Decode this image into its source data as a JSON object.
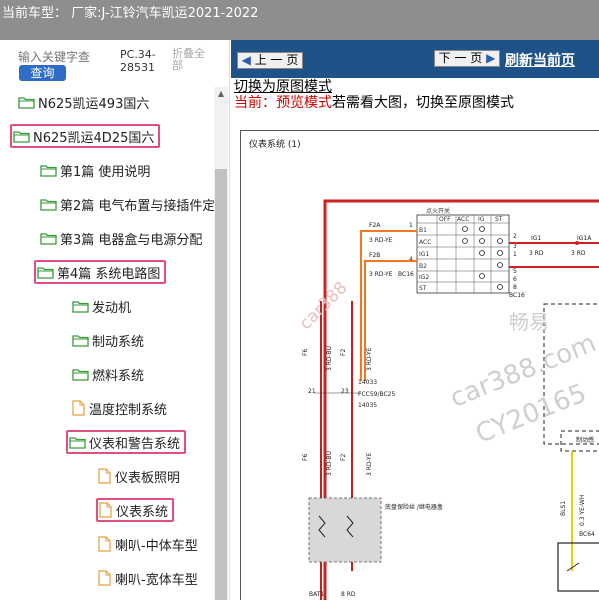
{
  "topbar": {
    "title": "当前车型： 厂家:J-江铃汽车凯运2021-2022"
  },
  "search": {
    "placeholder": "输入关键字查",
    "button_label": "查询",
    "pc_code": "PC.34-28531",
    "collapse_all": "折叠全部"
  },
  "tree": [
    {
      "label": "N625凯运493国六",
      "type": "folder",
      "highlighted": false
    },
    {
      "label": "N625凯运4D25国六",
      "type": "folder",
      "highlighted": true
    },
    {
      "label": "第1篇 使用说明",
      "type": "folder",
      "highlighted": false
    },
    {
      "label": "第2篇 电气布置与接插件定",
      "type": "folder",
      "highlighted": false
    },
    {
      "label": "第3篇 电器盒与电源分配",
      "type": "folder",
      "highlighted": false
    },
    {
      "label": "第4篇 系统电路图",
      "type": "folder",
      "highlighted": true
    },
    {
      "label": "发动机",
      "type": "folder",
      "highlighted": false
    },
    {
      "label": "制动系统",
      "type": "folder",
      "highlighted": false
    },
    {
      "label": "燃料系统",
      "type": "folder",
      "highlighted": false
    },
    {
      "label": "温度控制系统",
      "type": "doc",
      "highlighted": false
    },
    {
      "label": "仪表和警告系统",
      "type": "folder",
      "highlighted": true
    },
    {
      "label": "仪表板照明",
      "type": "doc",
      "highlighted": false
    },
    {
      "label": "仪表系统",
      "type": "doc",
      "highlighted": true
    },
    {
      "label": "喇叭-中体车型",
      "type": "doc",
      "highlighted": false
    },
    {
      "label": "喇叭-宽体车型",
      "type": "doc",
      "highlighted": false
    }
  ],
  "nav": {
    "prev_label": "上 一 页",
    "next_label": "下 一 页",
    "refresh_label": "刷新当前页"
  },
  "mode": {
    "switch_link": "切换为原图模式",
    "current_prefix": "当前：预览模式",
    "current_suffix": "若需看大图，切换至原图模式"
  },
  "diagram": {
    "title": "仪表系统 (1)",
    "switch_header": "点火开关",
    "switch_cols": [
      "OFF",
      "ACC",
      "IG",
      "ST"
    ],
    "switch_rows": [
      "B1",
      "ACC",
      "IG1",
      "B2",
      "IG2",
      "ST"
    ],
    "pins_left": [
      "1",
      "4"
    ],
    "pins_right": [
      "2",
      "3",
      "1",
      "5",
      "6",
      "8"
    ],
    "wires": {
      "f2a": "F2A",
      "f2b": "F2B",
      "rd_ye_1": "3 RD-YE",
      "rd_ye_2": "3 RD-YE",
      "bc16_left": "BC16",
      "ig1": "IG1",
      "ig1a": "IG1A",
      "rd_3a": "3 RD",
      "rd_3b": "3 RD",
      "bc16_right": "BC16",
      "f6": "F6",
      "f2": "F2",
      "rd_bu": "3 RD-BU",
      "rd_ye_v": "3 RD-YE",
      "c14033": "14033",
      "c14035": "14035",
      "fcc": "FCC59/BC25",
      "p21": "21",
      "p23": "23",
      "f6b": "F6",
      "f2c": "F2",
      "rd_bu_b": "3 RD-BU",
      "rd_ye_b": "3 RD-YE",
      "fuse_box": "底盘保险丝\n/继电器盒",
      "bat1": "BAT1",
      "rd8": "8 RD",
      "bls1": "BLS1",
      "wh": "0.3 YE-WH",
      "bc64": "BC64",
      "ctrl": "制动感"
    }
  },
  "watermarks": [
    "car388",
    "畅易",
    "car388.com",
    "CY20165"
  ]
}
